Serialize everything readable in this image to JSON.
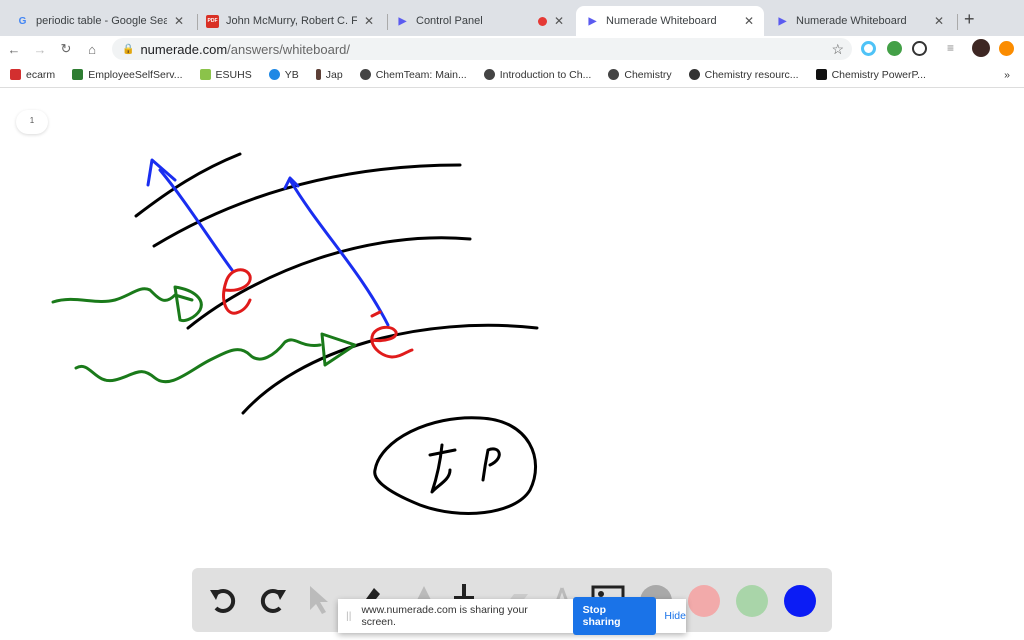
{
  "tabs": [
    {
      "title": "periodic table - Google Search",
      "icon": "google-icon"
    },
    {
      "title": "John McMurry, Robert C. Fay",
      "icon": "pdf-icon"
    },
    {
      "title": "Control Panel",
      "icon": "numerade-icon",
      "recording": true
    },
    {
      "title": "Numerade Whiteboard",
      "icon": "numerade-icon",
      "active": true
    },
    {
      "title": "Numerade Whiteboard",
      "icon": "numerade-icon"
    }
  ],
  "address": {
    "domain": "numerade.com",
    "path": "/answers/whiteboard/"
  },
  "bookmarks": [
    {
      "label": "ecarm",
      "color": "#d32f2f"
    },
    {
      "label": "EmployeeSelfServ...",
      "color": "#2e7d32"
    },
    {
      "label": "ESUHS",
      "color": "#8bc34a"
    },
    {
      "label": "YB",
      "color": "#1e88e5"
    },
    {
      "label": "Jap",
      "color": "#5d4037"
    },
    {
      "label": "ChemTeam: Main...",
      "color": "#444444"
    },
    {
      "label": "Introduction to Ch...",
      "color": "#444444"
    },
    {
      "label": "Chemistry",
      "color": "#444444"
    },
    {
      "label": "Chemistry resourc...",
      "color": "#333333"
    },
    {
      "label": "Chemistry PowerP...",
      "color": "#111111"
    }
  ],
  "bookmarks_more": "»",
  "page_number": "1",
  "toolbar": {
    "colors": [
      "#a9a9a9",
      "#f2aaaa",
      "#a9d5a9",
      "#0b1cf5"
    ],
    "selected_color": "#0b1cf5"
  },
  "share_bar": {
    "message": "www.numerade.com is sharing your screen.",
    "stop_label": "Stop sharing",
    "hide_label": "Hide"
  }
}
